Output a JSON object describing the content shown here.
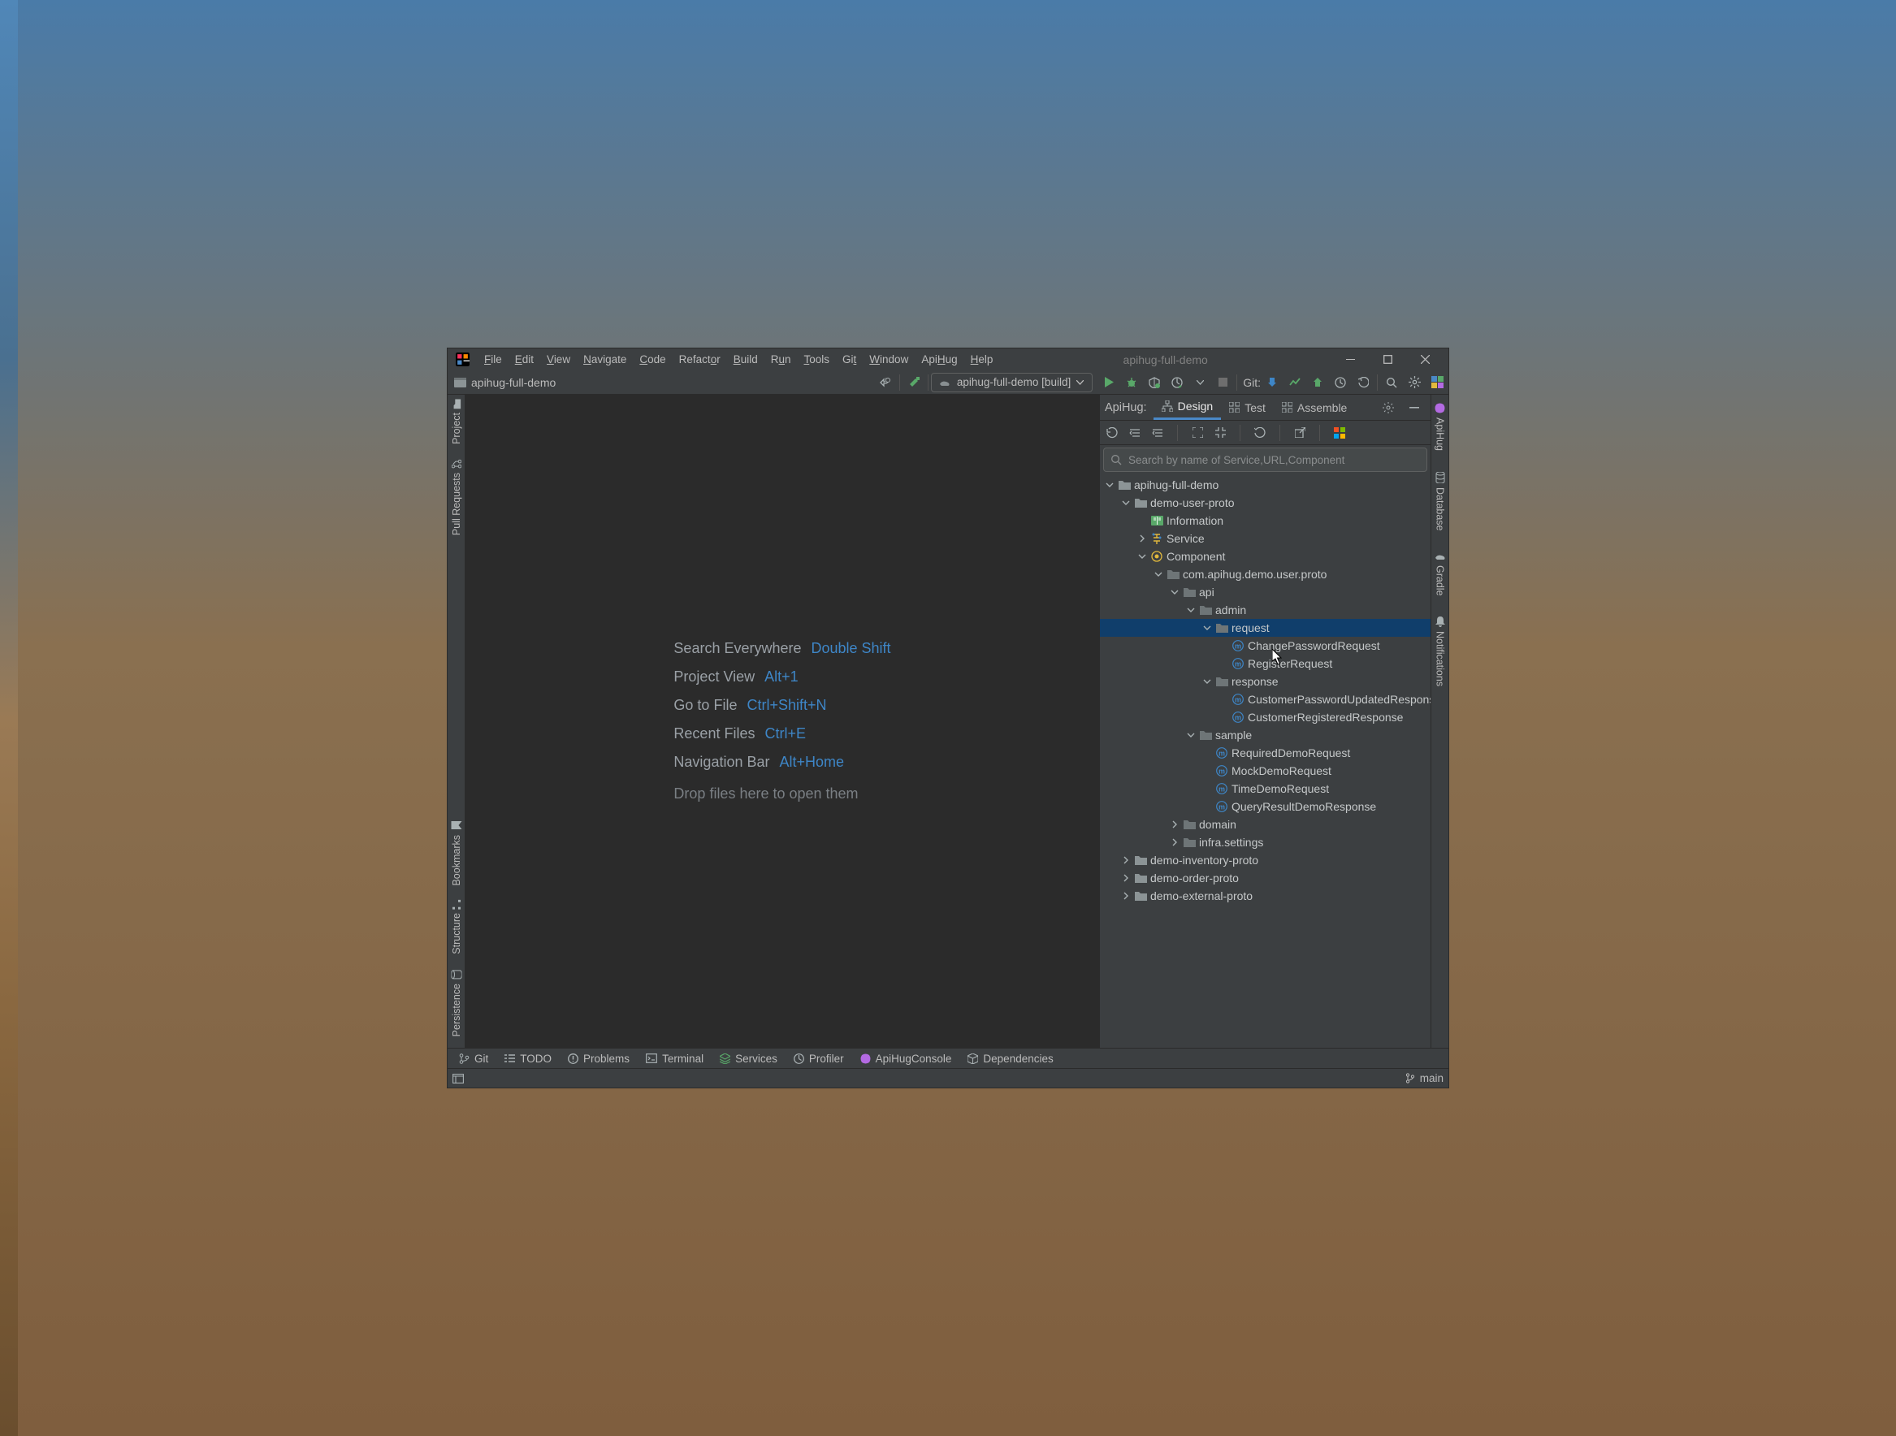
{
  "title_project": "apihug-full-demo",
  "menus": [
    "File",
    "Edit",
    "View",
    "Navigate",
    "Code",
    "Refactor",
    "Build",
    "Run",
    "Tools",
    "Git",
    "Window",
    "ApiHug",
    "Help"
  ],
  "menu_ul_idx": [
    0,
    0,
    0,
    0,
    0,
    6,
    0,
    1,
    0,
    2,
    0,
    3,
    0
  ],
  "breadcrumb_project": "apihug-full-demo",
  "run_config": "apihug-full-demo [build]",
  "git_label": "Git:",
  "left_tools": [
    "Project",
    "Pull Requests"
  ],
  "left_tools_bottom": [
    "Bookmarks",
    "Structure",
    "Persistence"
  ],
  "empty": [
    {
      "label": "Search Everywhere",
      "shortcut": "Double Shift"
    },
    {
      "label": "Project View",
      "shortcut": "Alt+1"
    },
    {
      "label": "Go to File",
      "shortcut": "Ctrl+Shift+N"
    },
    {
      "label": "Recent Files",
      "shortcut": "Ctrl+E"
    },
    {
      "label": "Navigation Bar",
      "shortcut": "Alt+Home"
    }
  ],
  "empty_drop": "Drop files here to open them",
  "apihug_brand": "ApiHug:",
  "apihug_tabs": [
    "Design",
    "Test",
    "Assemble"
  ],
  "search_placeholder": "Search by name of Service,URL,Component",
  "tree": {
    "root": "apihug-full-demo",
    "demo_user": "demo-user-proto",
    "information": "Information",
    "service": "Service",
    "component": "Component",
    "pkg": "com.apihug.demo.user.proto",
    "api": "api",
    "admin": "admin",
    "request": "request",
    "req1": "ChangePasswordRequest",
    "req2": "RegisterRequest",
    "response": "response",
    "res1": "CustomerPasswordUpdatedResponse",
    "res2": "CustomerRegisteredResponse",
    "sample": "sample",
    "s1": "RequiredDemoRequest",
    "s2": "MockDemoRequest",
    "s3": "TimeDemoRequest",
    "s4": "QueryResultDemoResponse",
    "domain": "domain",
    "infra": "infra.settings",
    "demo_inv": "demo-inventory-proto",
    "demo_order": "demo-order-proto",
    "demo_ext": "demo-external-proto"
  },
  "right_tools": [
    "ApiHug",
    "Database",
    "Gradle",
    "Notifications"
  ],
  "bottom_tabs": [
    "Git",
    "TODO",
    "Problems",
    "Terminal",
    "Services",
    "Profiler",
    "ApiHugConsole",
    "Dependencies"
  ],
  "branch": "main"
}
